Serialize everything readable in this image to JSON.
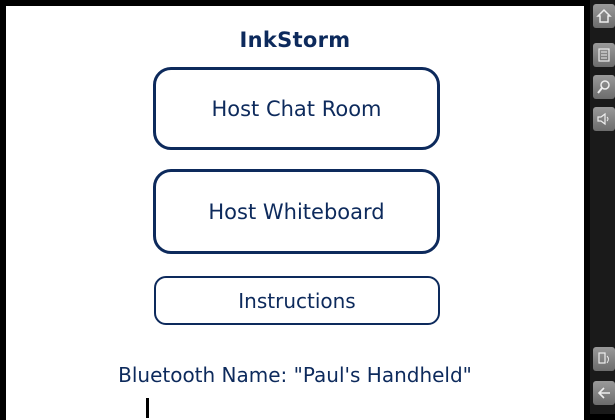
{
  "app": {
    "title": "InkStorm"
  },
  "buttons": {
    "host_chat_room": "Host Chat Room",
    "host_whiteboard": "Host Whiteboard",
    "instructions": "Instructions"
  },
  "status": {
    "bluetooth_name": "Bluetooth Name: \"Paul's Handheld\""
  },
  "sidebar": {
    "icons": [
      "home-icon",
      "menu-icon",
      "find-icon",
      "sound-icon",
      "rotate-icon",
      "back-icon"
    ]
  },
  "colors": {
    "primary": "#0d2a5c",
    "background": "#ffffff",
    "frame": "#000000"
  }
}
